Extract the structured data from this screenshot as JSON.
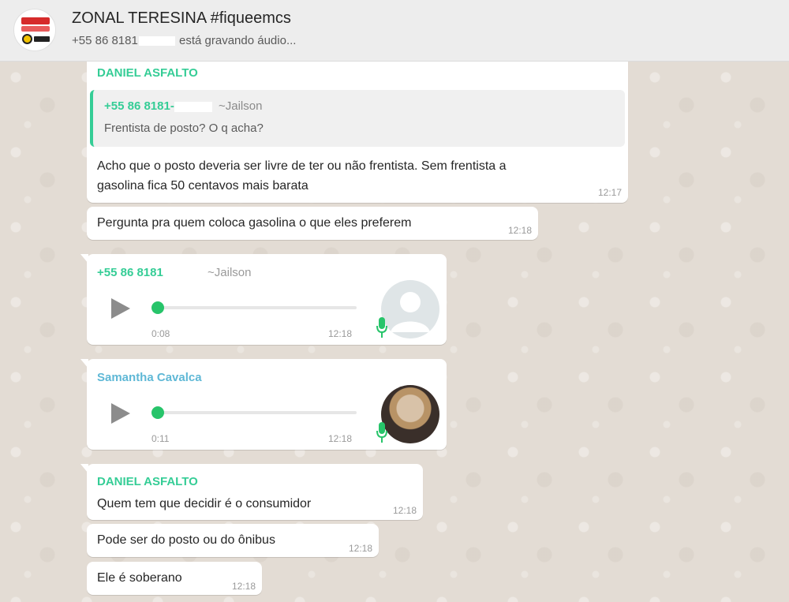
{
  "header": {
    "title": "ZONAL TERESINA #fiqueemcs",
    "status_prefix": "+55 86 8181",
    "status_suffix": " está gravando áudio..."
  },
  "messages": {
    "m1": {
      "sender": "DANIEL ASFALTO",
      "quote_phone": "+55 86 8181-",
      "quote_name": "~Jailson",
      "quote_text": "Frentista de posto? O q acha?",
      "line1": "Acho que o posto deveria ser livre de ter ou não frentista. Sem frentista a",
      "line2": "gasolina fica 50 centavos mais barata",
      "time": "12:17"
    },
    "m2": {
      "text": "Pergunta pra quem coloca gasolina o que eles preferem",
      "time": "12:18"
    },
    "m3": {
      "phone": "+55 86 8181",
      "name": "~Jailson",
      "duration": "0:08",
      "time": "12:18",
      "progress": 0
    },
    "m4": {
      "sender": "Samantha Cavalca",
      "duration": "0:11",
      "time": "12:18",
      "progress": 0
    },
    "m5": {
      "sender": "DANIEL ASFALTO",
      "text": "Quem tem que decidir é o consumidor",
      "time": "12:18"
    },
    "m6": {
      "text": "Pode ser do posto ou do ônibus",
      "time": "12:18"
    },
    "m7": {
      "text": "Ele é soberano",
      "time": "12:18"
    }
  },
  "colors": {
    "sender_green": "#35cd96",
    "sender_blue": "#5fb8d6",
    "progress_dot": "#27c46a",
    "mic": "#27c46a"
  },
  "icons": [
    "group-avatar",
    "play-icon",
    "mic-icon",
    "default-user-icon",
    "user-photo"
  ]
}
